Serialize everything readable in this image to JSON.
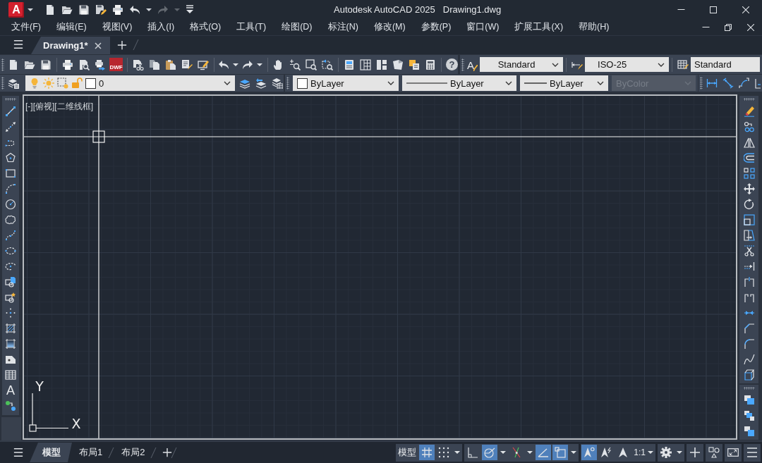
{
  "title_bar": {
    "app_logo": "A",
    "product": "Autodesk AutoCAD 2025",
    "file_name": "Drawing1.dwg"
  },
  "quick_access": [
    {
      "kind": "new",
      "disabled": false
    },
    {
      "kind": "open",
      "disabled": false
    },
    {
      "kind": "save",
      "disabled": false
    },
    {
      "kind": "save_as",
      "disabled": false
    },
    {
      "kind": "plot",
      "disabled": false
    },
    {
      "kind": "undo",
      "disabled": false
    },
    {
      "kind": "redo",
      "disabled": true
    },
    {
      "kind": "customize",
      "disabled": false
    }
  ],
  "menu_bar": [
    "文件(F)",
    "编辑(E)",
    "视图(V)",
    "插入(I)",
    "格式(O)",
    "工具(T)",
    "绘图(D)",
    "标注(N)",
    "修改(M)",
    "参数(P)",
    "窗口(W)",
    "扩展工具(X)",
    "帮助(H)"
  ],
  "document_tabs": [
    {
      "label": "Drawing1*",
      "selected": true
    }
  ],
  "standard_toolbar": {
    "dwf_badge": "DWF",
    "help_glyph": "?"
  },
  "styles_toolbar": {
    "text_style_glyph": "A",
    "text_style": "Standard",
    "dimension_style": "ISO-25",
    "table_style": "Standard"
  },
  "layers_toolbar": {
    "layer": {
      "name": "0",
      "on": true,
      "frozen": false,
      "viewport_frozen": false,
      "locked": false,
      "color": "#ffffff"
    }
  },
  "properties_toolbar": {
    "color_setting": "ByLayer",
    "linetype": "ByLayer",
    "lineweight": "ByLayer",
    "plot_style": {
      "value": "ByColor",
      "disabled": true
    }
  },
  "draw_toolbar": {
    "text_glyph": "A"
  },
  "viewport": {
    "label": "[-][俯视][二维线框]",
    "ucs": {
      "x_label": "X",
      "y_label": "Y"
    }
  },
  "layout_tabs": [
    {
      "label": "模型",
      "selected": true
    },
    {
      "label": "布局1",
      "selected": false
    },
    {
      "label": "布局2",
      "selected": false
    }
  ],
  "status_bar": {
    "space_button": "模型",
    "toggle_groups": [
      [
        {
          "kind": "grid",
          "on": true,
          "menu": false
        },
        {
          "kind": "snap",
          "on": false,
          "menu": true
        }
      ],
      [
        {
          "kind": "ortho",
          "on": false,
          "menu": false
        },
        {
          "kind": "polar",
          "on": true,
          "menu": true
        },
        {
          "kind": "object_snap_tracking",
          "on": false,
          "menu": true
        },
        {
          "kind": "isodraft",
          "on": true,
          "menu": false
        },
        {
          "kind": "object_snap",
          "on": true,
          "menu": true
        }
      ],
      [
        {
          "kind": "annotation_visibility",
          "on": true,
          "menu": false
        },
        {
          "kind": "autoscale",
          "on": false,
          "menu": false
        },
        {
          "kind": "annotation_scale",
          "on": false,
          "menu": false
        }
      ]
    ],
    "annotation_scale": "1:1"
  }
}
